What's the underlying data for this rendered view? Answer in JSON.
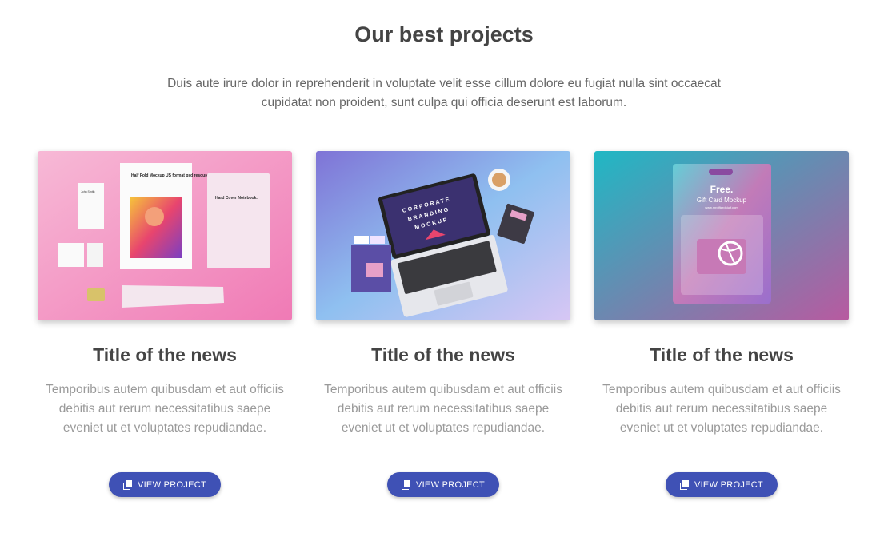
{
  "section": {
    "title": "Our best projects",
    "intro": "Duis aute irure dolor in reprehenderit in voluptate velit esse cillum dolore eu fugiat nulla sint occaecat cupidatat non proident, sunt culpa qui officia deserunt est laborum."
  },
  "projects": [
    {
      "title": "Title of the news",
      "text": "Temporibus autem quibusdam et aut officiis debitis aut rerum necessitatibus saepe eveniet ut et voluptates repudiandae.",
      "button_label": "VIEW PROJECT",
      "image": {
        "brochure_title": "Half Fold Mockup US format psd resource Brochure Template.",
        "notebook_title": "Hard Cover Notebook.",
        "card_name": "John Smith"
      }
    },
    {
      "title": "Title of the news",
      "text": "Temporibus autem quibusdam et aut officiis debitis aut rerum necessitatibus saepe eveniet ut et voluptates repudiandae.",
      "button_label": "VIEW PROJECT",
      "image": {
        "screen_line1": "CORPORATE",
        "screen_line2": "BRANDING",
        "screen_line3": "MOCKUP"
      }
    },
    {
      "title": "Title of the news",
      "text": "Temporibus autem quibusdam et aut officiis debitis aut rerum necessitatibus saepe eveniet ut et voluptates repudiandae.",
      "button_label": "VIEW PROJECT",
      "image": {
        "headline": "Free.",
        "subline": "Gift Card Mockup",
        "url": "www.mrgiftardstuff.com"
      }
    }
  ],
  "icons": {
    "button": "copy-icon"
  },
  "colors": {
    "button": "#3f51b5",
    "heading": "#444444",
    "body": "#9a9a9a"
  }
}
